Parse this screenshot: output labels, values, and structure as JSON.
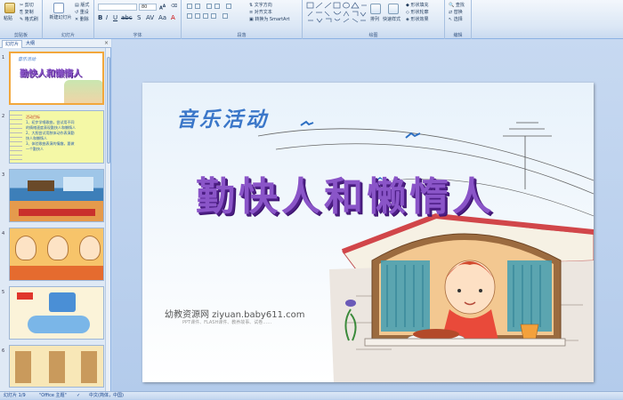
{
  "ribbon": {
    "clipboard": {
      "group_label": "剪贴板",
      "paste": "粘贴",
      "cut": "剪切",
      "copy": "复制",
      "format_painter": "格式刷"
    },
    "slides": {
      "group_label": "幻灯片",
      "new_slide": "新建幻灯片",
      "layout": "版式",
      "reset": "重设",
      "delete": "删除"
    },
    "font": {
      "group_label": "字体",
      "font_name": "",
      "font_size": "80"
    },
    "paragraph": {
      "group_label": "段落",
      "text_direction": "文字方向",
      "align_text": "对齐文本",
      "smartart": "转换为 SmartArt"
    },
    "drawing": {
      "group_label": "绘图",
      "arrange": "排列",
      "quick_styles": "快速样式",
      "shape_fill": "形状填充",
      "shape_outline": "形状轮廓",
      "shape_effects": "形状效果"
    },
    "editing": {
      "group_label": "编辑",
      "find": "查找",
      "replace": "替换",
      "select": "选择"
    }
  },
  "panel": {
    "tab_slides": "幻灯片",
    "tab_outline": "大纲",
    "close": "×",
    "thumbnails": [
      {
        "number": "1"
      },
      {
        "number": "2"
      },
      {
        "number": "3"
      },
      {
        "number": "4"
      },
      {
        "number": "5"
      },
      {
        "number": "6"
      }
    ],
    "thumb1_title": "勤快人和懒惰人",
    "thumb1_sub": "音乐活动",
    "thumb2_lines": [
      "活动目标",
      "1、初步学唱歌曲，尝试用不同",
      "的情绪速度表现勤快人和懒惰人",
      "2、大胆尝试用肢体动作表演勤",
      "快人和懒惰人",
      "3、体验歌曲表演的情趣，要做",
      "一个勤快人"
    ]
  },
  "slide": {
    "subtitle": "音乐活动",
    "title": "勤快人和懒惰人",
    "footer": "幼教资源网 ziyuan.baby611.com",
    "footer_sub": "PPT课件、FLASH课件、教养故事、试卷……"
  },
  "status": {
    "slide_count": "幻灯片 1/9",
    "theme": "\"Office 主题\"",
    "language": "中文(简体，中国)"
  },
  "colors": {
    "title_purple": "#8a55c8",
    "subtitle_blue": "#3b77c9",
    "selection_orange": "#f2a73b"
  }
}
